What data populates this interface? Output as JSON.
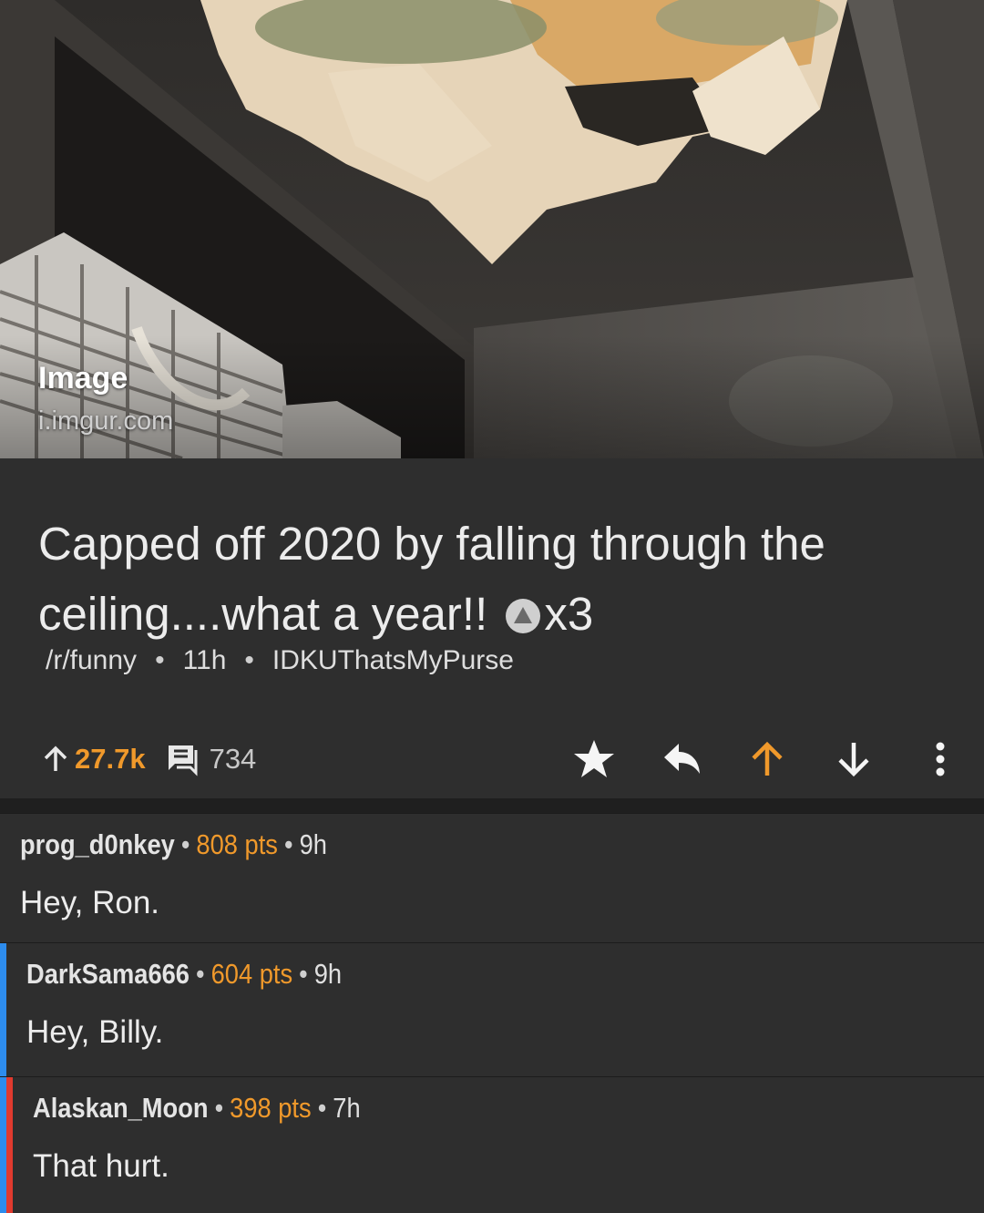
{
  "hero": {
    "label": "Image",
    "domain": "i.imgur.com"
  },
  "post": {
    "title": "Capped off 2020 by falling through the ceiling....what a year!!",
    "award_count": "x3",
    "subreddit": "/r/funny",
    "age": "11h",
    "author": "IDKUThatsMyPurse",
    "score": "27.7k",
    "comments": "734"
  },
  "colors": {
    "accent": "#f0992b",
    "background": "#2e2e2e",
    "depth2": "#2d8ced",
    "depth3": "#e03a2e"
  },
  "icons": [
    "upvote-arrow-icon",
    "comment-icon",
    "star-icon",
    "reply-icon",
    "upvote-icon",
    "downvote-icon",
    "more-vertical-icon",
    "award-icon"
  ],
  "comments": [
    {
      "user": "prog_d0nkey",
      "points": "808 pts",
      "age": "9h",
      "body": "Hey, Ron."
    },
    {
      "user": "DarkSama666",
      "points": "604 pts",
      "age": "9h",
      "body": "Hey, Billy."
    },
    {
      "user": "Alaskan_Moon",
      "points": "398 pts",
      "age": "7h",
      "body": "That hurt."
    }
  ]
}
